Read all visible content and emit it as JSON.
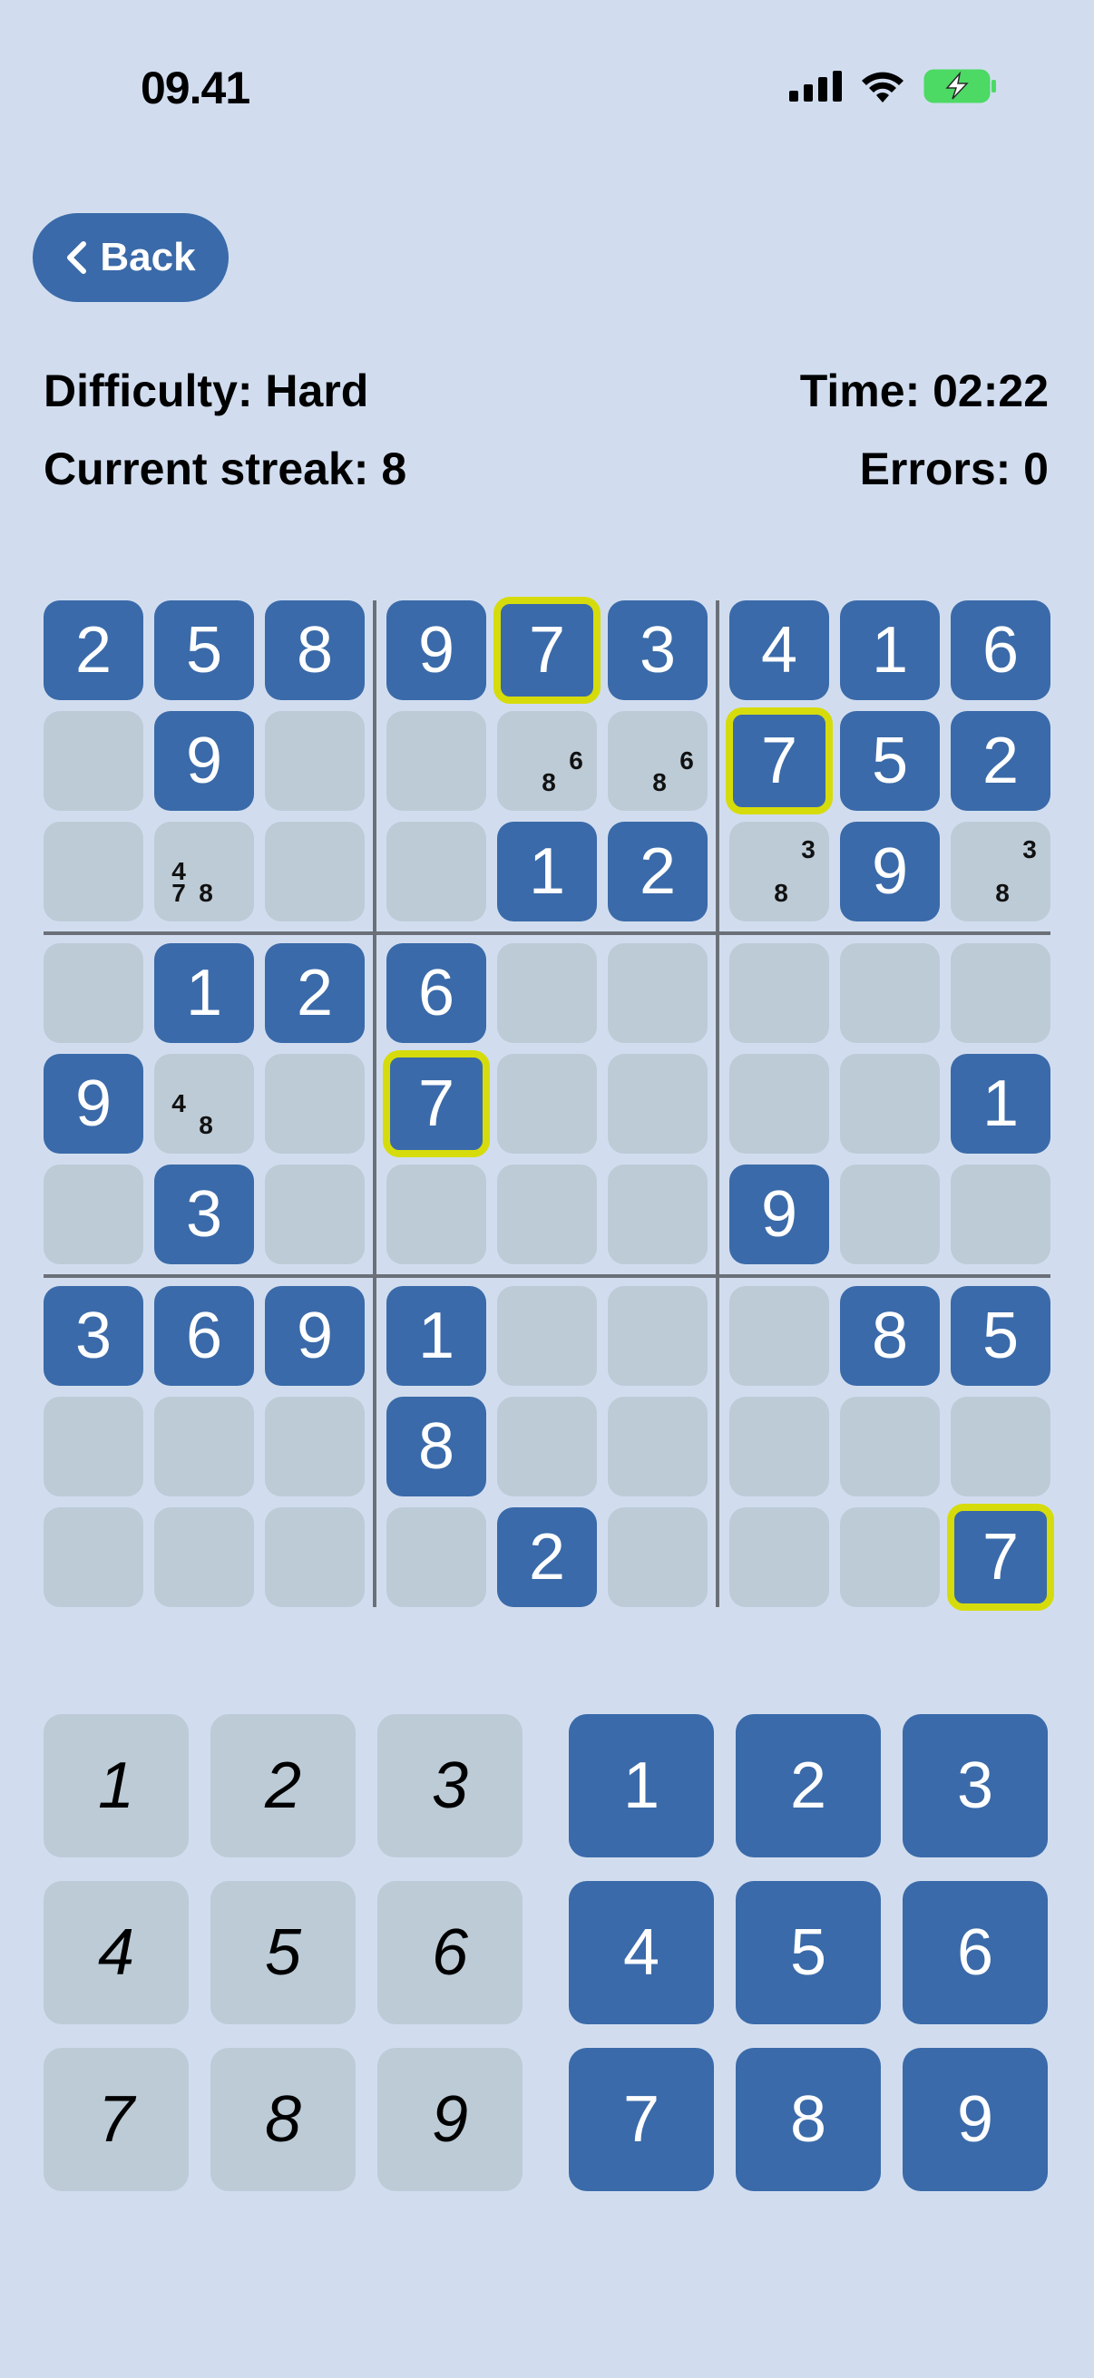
{
  "status_bar": {
    "time": "09.41",
    "icons": [
      "signal-icon",
      "wifi-icon",
      "battery-charging-icon"
    ]
  },
  "nav": {
    "back_label": "Back"
  },
  "stats": {
    "difficulty": "Difficulty: Hard",
    "time": "Time: 02:22",
    "streak": "Current streak: 8",
    "errors": "Errors: 0"
  },
  "colors": {
    "background": "#d1ddef",
    "filled_cell": "#3a6aa9",
    "empty_cell": "#bccbd6",
    "highlight": "#d6dc0c"
  },
  "board": {
    "rows": [
      [
        "2",
        "5",
        "8",
        "9",
        "7",
        "3",
        "4",
        "1",
        "6"
      ],
      [
        "",
        "9",
        "",
        "",
        "",
        "",
        "7",
        "5",
        "2"
      ],
      [
        "",
        "",
        "",
        "",
        "1",
        "2",
        "",
        "9",
        ""
      ],
      [
        "",
        "1",
        "2",
        "6",
        "",
        "",
        "",
        "",
        ""
      ],
      [
        "9",
        "",
        "",
        "7",
        "",
        "",
        "",
        "",
        "1"
      ],
      [
        "",
        "3",
        "",
        "",
        "",
        "",
        "9",
        "",
        ""
      ],
      [
        "3",
        "6",
        "9",
        "1",
        "",
        "",
        "",
        "8",
        "5"
      ],
      [
        "",
        "",
        "",
        "8",
        "",
        "",
        "",
        "",
        ""
      ],
      [
        "",
        "",
        "",
        "",
        "2",
        "",
        "",
        "",
        "7"
      ]
    ],
    "selected": [
      [
        0,
        4
      ],
      [
        1,
        6
      ],
      [
        4,
        3
      ],
      [
        8,
        8
      ]
    ],
    "notes": {
      "1-4": [
        "6",
        "8"
      ],
      "1-5": [
        "6",
        "8"
      ],
      "2-1": [
        "4",
        "7",
        "8"
      ],
      "2-6": [
        "3",
        "8"
      ],
      "2-8": [
        "3",
        "8"
      ],
      "4-1": [
        "4",
        "8"
      ]
    }
  },
  "keypad": {
    "note_keys": [
      "1",
      "2",
      "3",
      "4",
      "5",
      "6",
      "7",
      "8",
      "9"
    ],
    "value_keys": [
      "1",
      "2",
      "3",
      "4",
      "5",
      "6",
      "7",
      "8",
      "9"
    ]
  }
}
